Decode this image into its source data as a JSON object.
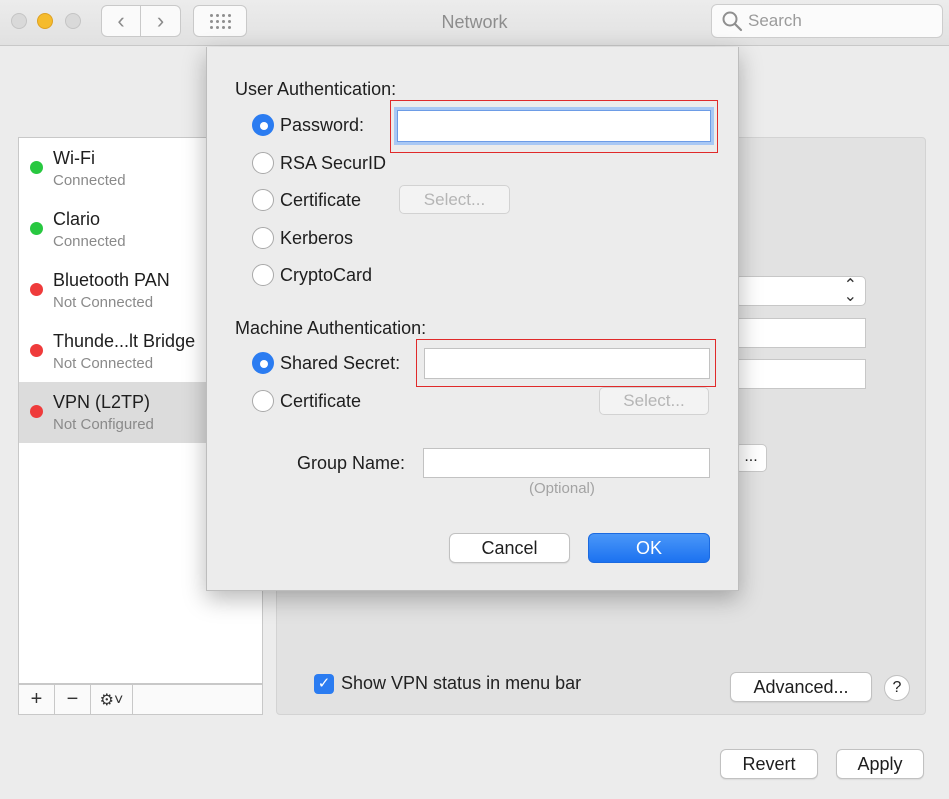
{
  "window": {
    "title": "Network"
  },
  "toolbar": {
    "search_placeholder": "Search",
    "back_glyph": "‹",
    "forward_glyph": "›"
  },
  "services": [
    {
      "name": "Wi-Fi",
      "status": "Connected",
      "status_color": "#28c840"
    },
    {
      "name": "Clario",
      "status": "Connected",
      "status_color": "#28c840"
    },
    {
      "name": "Bluetooth PAN",
      "status": "Not Connected",
      "status_color": "#ef3b3b"
    },
    {
      "name": "Thunde...lt Bridge",
      "status": "Not Connected",
      "status_color": "#ef3b3b"
    },
    {
      "name": "VPN (L2TP)",
      "status": "Not Configured",
      "status_color": "#ef3b3b",
      "selected": true
    }
  ],
  "sidebar_tools": {
    "add": "+",
    "remove": "−",
    "action": "⚙˅"
  },
  "pane": {
    "show_vpn_status_label": "Show VPN status in menu bar",
    "show_vpn_status_checked": true,
    "advanced_label": "Advanced...",
    "help_label": "?",
    "ellipsis_button": "..."
  },
  "footer": {
    "revert_label": "Revert",
    "apply_label": "Apply"
  },
  "auth_sheet": {
    "user_auth_label": "User Authentication:",
    "user_options": [
      {
        "label": "Password:",
        "selected": true
      },
      {
        "label": "RSA SecurID",
        "selected": false
      },
      {
        "label": "Certificate",
        "selected": false
      },
      {
        "label": "Kerberos",
        "selected": false
      },
      {
        "label": "CryptoCard",
        "selected": false
      }
    ],
    "password_value": "",
    "user_cert_select": "Select...",
    "machine_auth_label": "Machine Authentication:",
    "machine_options": [
      {
        "label": "Shared Secret:",
        "selected": true
      },
      {
        "label": "Certificate",
        "selected": false
      }
    ],
    "shared_secret_value": "",
    "machine_cert_select": "Select...",
    "group_name_label": "Group Name:",
    "group_name_value": "",
    "group_name_hint": "(Optional)",
    "cancel_label": "Cancel",
    "ok_label": "OK",
    "accent_color": "#2b7cf1",
    "highlight_color": "#e02a2a"
  }
}
